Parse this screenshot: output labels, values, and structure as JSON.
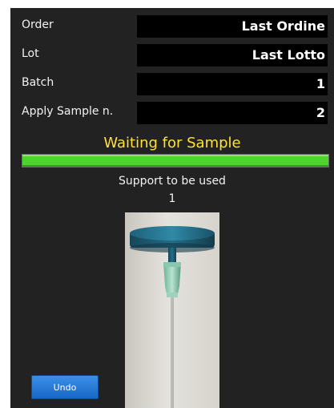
{
  "fields": [
    {
      "label": "Order",
      "value": "Last Ordine"
    },
    {
      "label": "Lot",
      "value": "Last Lotto"
    },
    {
      "label": "Batch",
      "value": "1"
    },
    {
      "label": "Apply Sample n.",
      "value": "2"
    }
  ],
  "status": {
    "text": "Waiting for Sample",
    "progress": 1.0,
    "text_color": "#ffe135",
    "bar_color": "#4fd32e"
  },
  "support": {
    "label": "Support to be used",
    "count": "1",
    "image": "needle-support-photo"
  },
  "actions": {
    "undo_label": "Undo",
    "undo_color": "#1f78d8"
  },
  "theme": {
    "panel_bg": "#222222",
    "field_bg": "#000000"
  }
}
